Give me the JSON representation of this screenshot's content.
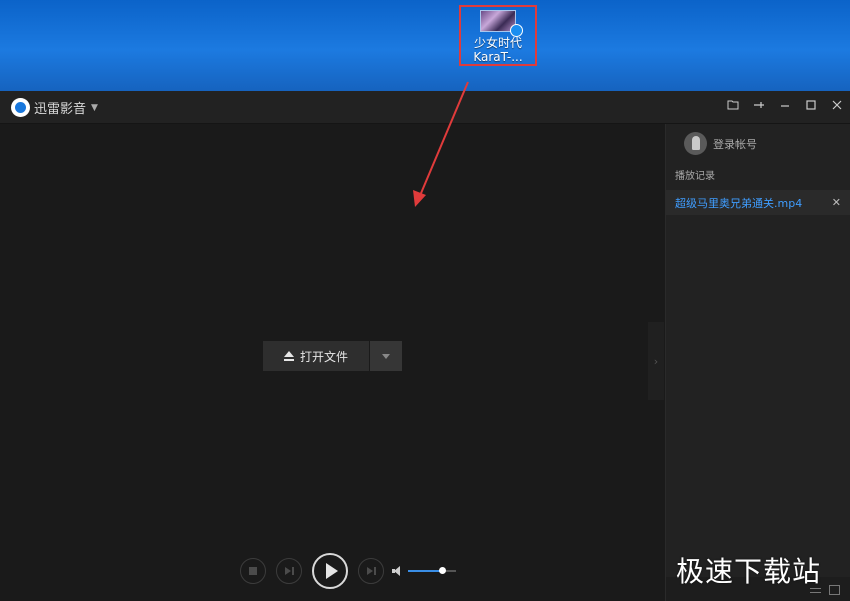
{
  "desktop": {
    "icon_label_line1": "少女时代",
    "icon_label_line2": "KaraT-..."
  },
  "titlebar": {
    "app_name": "迅雷影音",
    "icons": [
      "folder-icon",
      "pin-icon",
      "minimize-icon",
      "maximize-icon",
      "close-icon"
    ]
  },
  "player": {
    "open_file_label": "打开文件",
    "volume_level": 0.7
  },
  "sidebar": {
    "login_label": "登录帐号",
    "history_title": "播放记录",
    "history_items": [
      {
        "name": "超级马里奥兄弟通关.mp4"
      }
    ]
  },
  "overlay": {
    "highlight_color": "#e03b3b",
    "watermark": "极速下载站"
  },
  "colors": {
    "accent": "#3f9dff",
    "desktop_blue": "#1c7ae0",
    "window_bg": "#1a1a1a"
  }
}
